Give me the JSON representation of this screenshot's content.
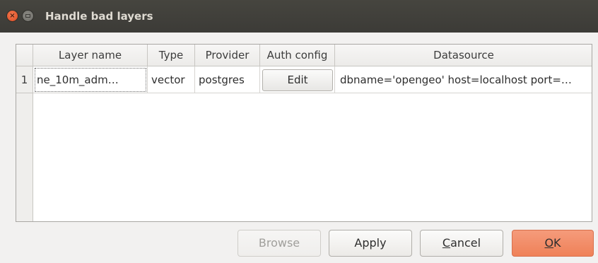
{
  "window": {
    "title": "Handle bad layers"
  },
  "table": {
    "columns": [
      "Layer name",
      "Type",
      "Provider",
      "Auth config",
      "Datasource"
    ],
    "rows": [
      {
        "num": "1",
        "layer_name": "ne_10m_adm…",
        "type": "vector",
        "provider": "postgres",
        "auth_button": "Edit",
        "datasource": "dbname='opengeo' host=localhost port=…"
      }
    ]
  },
  "buttons": {
    "browse": "Browse",
    "apply": "Apply",
    "cancel_pre": "",
    "cancel_mnemonic": "C",
    "cancel_post": "ancel",
    "ok_mnemonic": "O",
    "ok_post": "K"
  },
  "colors": {
    "titlebar": "#3c3b37",
    "ok_accent": "#ef8158",
    "close_button": "#dc4a21"
  }
}
